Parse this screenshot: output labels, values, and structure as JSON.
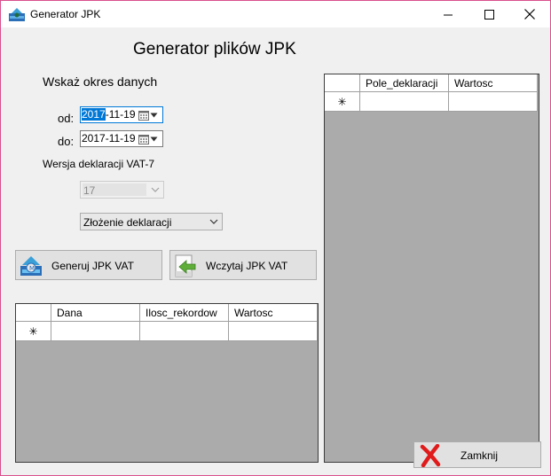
{
  "window": {
    "title": "Generator JPK",
    "controls": {
      "minimize": "minimize",
      "maximize": "maximize",
      "close": "close"
    }
  },
  "header": {
    "title": "Generator plików JPK"
  },
  "period": {
    "section_label": "Wskaż okres danych",
    "from_label": "od:",
    "from_value_selected": "2017",
    "from_value_rest": "-11-19",
    "to_label": "do:",
    "to_value": "2017-11-19"
  },
  "vat": {
    "version_label": "Wersja deklaracji VAT-7",
    "version_value": "17",
    "declaration_type": "Złożenie deklaracji"
  },
  "buttons": {
    "generate": "Generuj JPK VAT",
    "load": "Wczytaj JPK VAT",
    "close": "Zamknij"
  },
  "left_grid": {
    "columns": [
      "Dana",
      "Ilosc_rekordow",
      "Wartosc"
    ],
    "new_row_marker": "✳"
  },
  "right_grid": {
    "columns": [
      "Pole_deklaracji",
      "Wartosc"
    ],
    "new_row_marker": "✳"
  },
  "colors": {
    "accent": "#0078d7",
    "grid_bg": "#ababab",
    "window_border": "#d94f8c"
  },
  "icons": [
    "jpk-app-icon",
    "calendar-icon",
    "chevron-down-icon",
    "generate-icon",
    "load-file-icon",
    "red-x-icon"
  ]
}
